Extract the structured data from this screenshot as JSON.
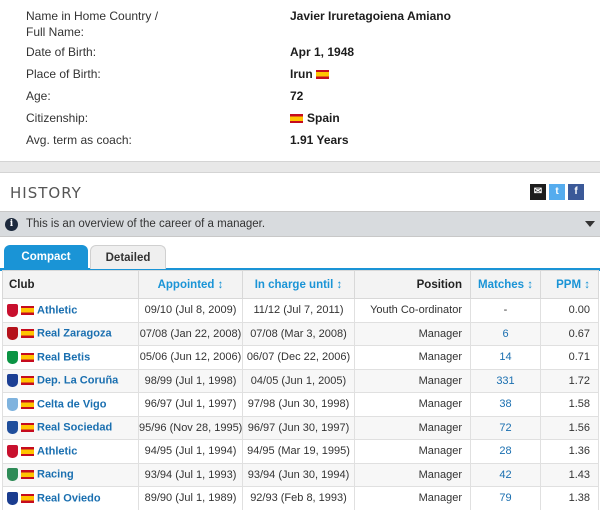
{
  "profile": {
    "rows": [
      {
        "label": "Name in Home Country /",
        "label2": "Full Name:",
        "value": "Javier Iruretagoiena Amiano",
        "flag": false
      },
      {
        "label": "Date of Birth:",
        "label2": "",
        "value": "Apr 1, 1948",
        "flag": false
      },
      {
        "label": "Place of Birth:",
        "label2": "",
        "value": "Irun",
        "flag": true,
        "flag_after": true
      },
      {
        "label": "Age:",
        "label2": "",
        "value": "72",
        "flag": false
      },
      {
        "label": "Citizenship:",
        "label2": "",
        "value": "Spain",
        "flag": true,
        "flag_after": false
      },
      {
        "label": "Avg. term as coach:",
        "label2": "",
        "value": "1.91 Years",
        "flag": false
      }
    ]
  },
  "history": {
    "title": "HISTORY",
    "share_icons": [
      "mail-icon",
      "twitter-icon",
      "facebook-icon"
    ],
    "notice": "This is an overview of the career of a manager.",
    "tabs": [
      "Compact",
      "Detailed"
    ],
    "active_tab": "Compact",
    "columns": {
      "club": "Club",
      "appointed": "Appointed ↕",
      "in_charge_until": "In charge until ↕",
      "position": "Position",
      "matches": "Matches ↕",
      "ppm": "PPM ↕"
    },
    "rows": [
      {
        "club": "Athletic",
        "crest_color": "#c8102e",
        "appointed": "09/10 (Jul 8, 2009)",
        "until": "11/12 (Jul 7, 2011)",
        "position": "Youth Co-ordinator",
        "matches": "-",
        "ppm": "0.00"
      },
      {
        "club": "Real Zaragoza",
        "crest_color": "#b5121b",
        "appointed": "07/08 (Jan 22, 2008)",
        "until": "07/08 (Mar 3, 2008)",
        "position": "Manager",
        "matches": "6",
        "ppm": "0.67"
      },
      {
        "club": "Real Betis",
        "crest_color": "#0b9444",
        "appointed": "05/06 (Jun 12, 2006)",
        "until": "06/07 (Dec 22, 2006)",
        "position": "Manager",
        "matches": "14",
        "ppm": "0.71"
      },
      {
        "club": "Dep. La Coruña",
        "crest_color": "#1c3f94",
        "appointed": "98/99 (Jul 1, 1998)",
        "until": "04/05 (Jun 1, 2005)",
        "position": "Manager",
        "matches": "331",
        "ppm": "1.72"
      },
      {
        "club": "Celta de Vigo",
        "crest_color": "#7fb3de",
        "appointed": "96/97 (Jul 1, 1997)",
        "until": "97/98 (Jun 30, 1998)",
        "position": "Manager",
        "matches": "38",
        "ppm": "1.58"
      },
      {
        "club": "Real Sociedad",
        "crest_color": "#1f4e9c",
        "appointed": "95/96 (Nov 28, 1995)",
        "until": "96/97 (Jun 30, 1997)",
        "position": "Manager",
        "matches": "72",
        "ppm": "1.56"
      },
      {
        "club": "Athletic",
        "crest_color": "#c8102e",
        "appointed": "94/95 (Jul 1, 1994)",
        "until": "94/95 (Mar 19, 1995)",
        "position": "Manager",
        "matches": "28",
        "ppm": "1.36"
      },
      {
        "club": "Racing",
        "crest_color": "#2e8b57",
        "appointed": "93/94 (Jul 1, 1993)",
        "until": "93/94 (Jun 30, 1994)",
        "position": "Manager",
        "matches": "42",
        "ppm": "1.43"
      },
      {
        "club": "Real Oviedo",
        "crest_color": "#1a3c8f",
        "appointed": "89/90 (Jul 1, 1989)",
        "until": "92/93 (Feb 8, 1993)",
        "position": "Manager",
        "matches": "79",
        "ppm": "1.38"
      }
    ]
  }
}
